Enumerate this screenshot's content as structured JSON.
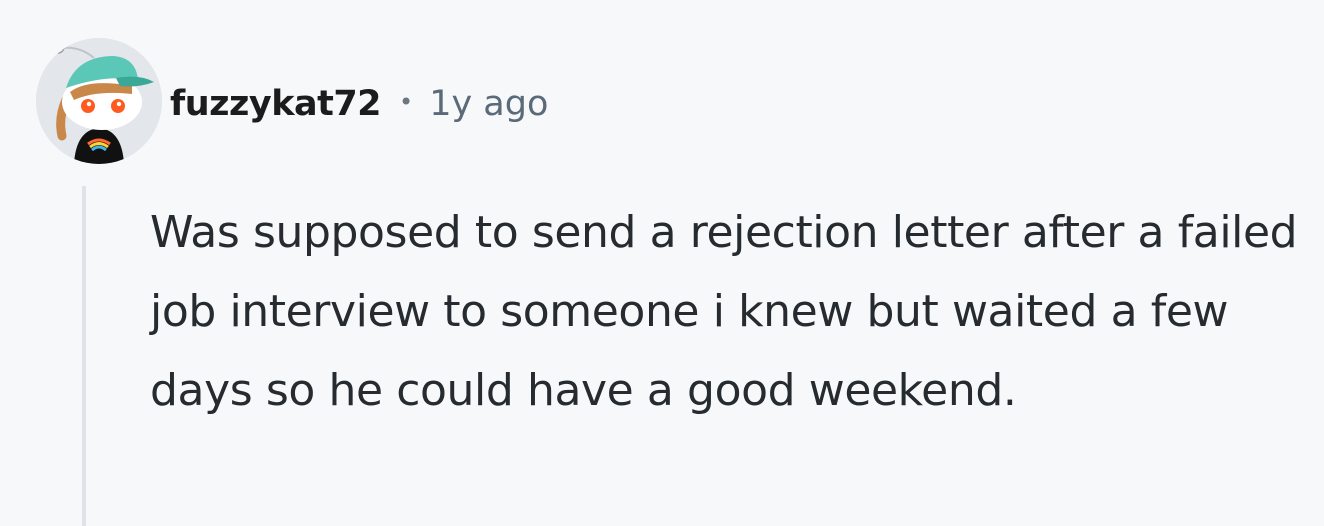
{
  "comment": {
    "author": "fuzzykat72",
    "separator": "•",
    "timestamp": "1y ago",
    "body": "Was supposed to send a rejection letter after a failed job interview to someone i knew but waited a few days so he could have a good weekend."
  },
  "avatar": {
    "icon": "snoo-avatar-icon",
    "colors": {
      "cap": "#5bc7b7",
      "hair": "#c9884a",
      "eyes": "#ff5a1f",
      "shirt": "#111111",
      "background": "#e3e6ea"
    }
  },
  "colors": {
    "page_background": "#f7f8fa",
    "text_primary": "#262b30",
    "text_meta": "#5a6a78",
    "thread_line": "#dfe3e8"
  }
}
